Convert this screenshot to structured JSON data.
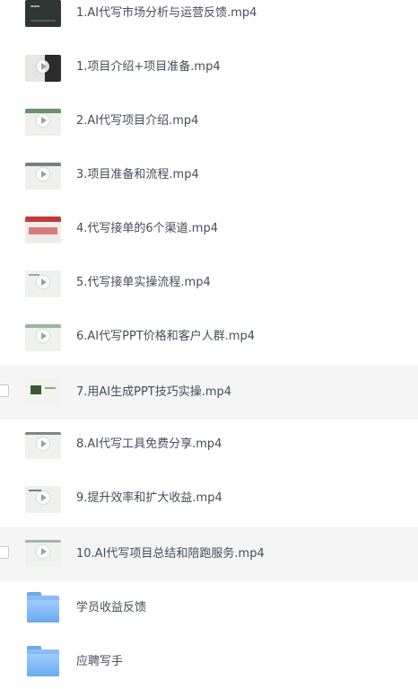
{
  "files": [
    {
      "name": "1.AI代写市场分析与运营反馈.mp4",
      "type": "video",
      "thumb": "dark"
    },
    {
      "name": "1.项目介绍+项目准备.mp4",
      "type": "video",
      "thumb": "light-dark"
    },
    {
      "name": "2.AI代写项目介绍.mp4",
      "type": "video",
      "thumb": "light"
    },
    {
      "name": "3.项目准备和流程.mp4",
      "type": "video",
      "thumb": "light"
    },
    {
      "name": "4.代写接单的6个渠道.mp4",
      "type": "video",
      "thumb": "red"
    },
    {
      "name": "5.代写接单实操流程.mp4",
      "type": "video",
      "thumb": "light"
    },
    {
      "name": "6.AI代写PPT价格和客户人群.mp4",
      "type": "video",
      "thumb": "light"
    },
    {
      "name": "7.用AI生成PPT技巧实操.mp4",
      "type": "video",
      "thumb": "light-green",
      "highlighted": true
    },
    {
      "name": "8.AI代写工具免费分享.mp4",
      "type": "video",
      "thumb": "light"
    },
    {
      "name": "9.提升效率和扩大收益.mp4",
      "type": "video",
      "thumb": "light"
    },
    {
      "name": "10.AI代写项目总结和陪跑服务.mp4",
      "type": "video",
      "thumb": "light",
      "highlighted": true
    },
    {
      "name": "学员收益反馈",
      "type": "folder"
    },
    {
      "name": "应聘写手",
      "type": "folder"
    }
  ],
  "colors": {
    "text": "#454d5a",
    "hover_row": "#f5f5f6",
    "folder_blue": "#6aaaf0"
  }
}
